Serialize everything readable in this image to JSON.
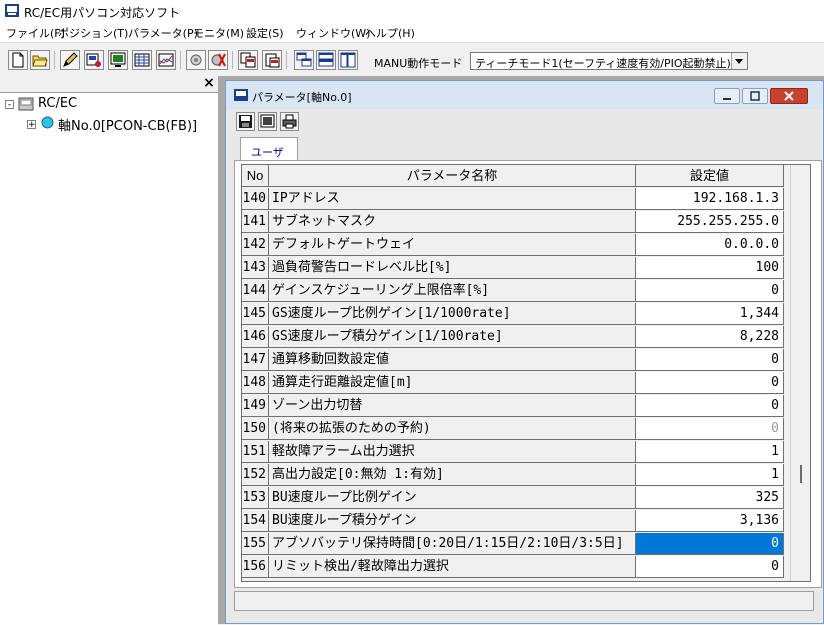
{
  "app": {
    "title": "RC/EC用パソコン対応ソフト"
  },
  "menu": [
    {
      "label": "ファイル(F)"
    },
    {
      "label": "ポジション(T)"
    },
    {
      "label": "パラメータ(P)"
    },
    {
      "label": "モニタ(M)"
    },
    {
      "label": "設定(S)"
    },
    {
      "label": "ウィンドウ(W)"
    },
    {
      "label": "ヘルプ(H)"
    }
  ],
  "toolbar": {
    "mode_label": "MANU動作モード",
    "mode_value": "ティーチモード1(セーフティ速度有効/PIO起動禁止)"
  },
  "tree": {
    "close": "×",
    "root_label": "RC/EC",
    "root_toggle": "-",
    "child_label": "軸No.0[PCON-CB(FB)]",
    "child_toggle": "+"
  },
  "child_window": {
    "title": "パラメータ[軸No.0]",
    "tab_label": "ユーザ"
  },
  "grid": {
    "headers": {
      "no": "No",
      "name": "パラメータ名称",
      "value": "設定値"
    },
    "rows": [
      {
        "no": "140",
        "name": "IPアドレス",
        "value": "192.168.1.3"
      },
      {
        "no": "141",
        "name": "サブネットマスク",
        "value": "255.255.255.0"
      },
      {
        "no": "142",
        "name": "デフォルトゲートウェイ",
        "value": "0.0.0.0"
      },
      {
        "no": "143",
        "name": "過負荷警告ロードレベル比[%]",
        "value": "100"
      },
      {
        "no": "144",
        "name": "ゲインスケジューリング上限倍率[%]",
        "value": "0"
      },
      {
        "no": "145",
        "name": "GS速度ループ比例ゲイン[1/1000rate]",
        "value": "1,344"
      },
      {
        "no": "146",
        "name": "GS速度ループ積分ゲイン[1/100rate]",
        "value": "8,228"
      },
      {
        "no": "147",
        "name": "通算移動回数設定値",
        "value": "0"
      },
      {
        "no": "148",
        "name": "通算走行距離設定値[m]",
        "value": "0"
      },
      {
        "no": "149",
        "name": "ゾーン出力切替",
        "value": "0"
      },
      {
        "no": "150",
        "name": "(将来の拡張のための予約)",
        "value": "0"
      },
      {
        "no": "151",
        "name": "軽故障アラーム出力選択",
        "value": "1"
      },
      {
        "no": "152",
        "name": "高出力設定[0:無効 1:有効]",
        "value": "1"
      },
      {
        "no": "153",
        "name": "BU速度ループ比例ゲイン",
        "value": "325"
      },
      {
        "no": "154",
        "name": "BU速度ループ積分ゲイン",
        "value": "3,136"
      },
      {
        "no": "155",
        "name": "アブソバッテリ保持時間[0:20日/1:15日/2:10日/3:5日]",
        "value": "0"
      },
      {
        "no": "156",
        "name": "リミット検出/軽故障出力選択",
        "value": "0"
      }
    ]
  },
  "colors": {
    "selection": "#0078d7",
    "title_accent": "#00008b"
  }
}
